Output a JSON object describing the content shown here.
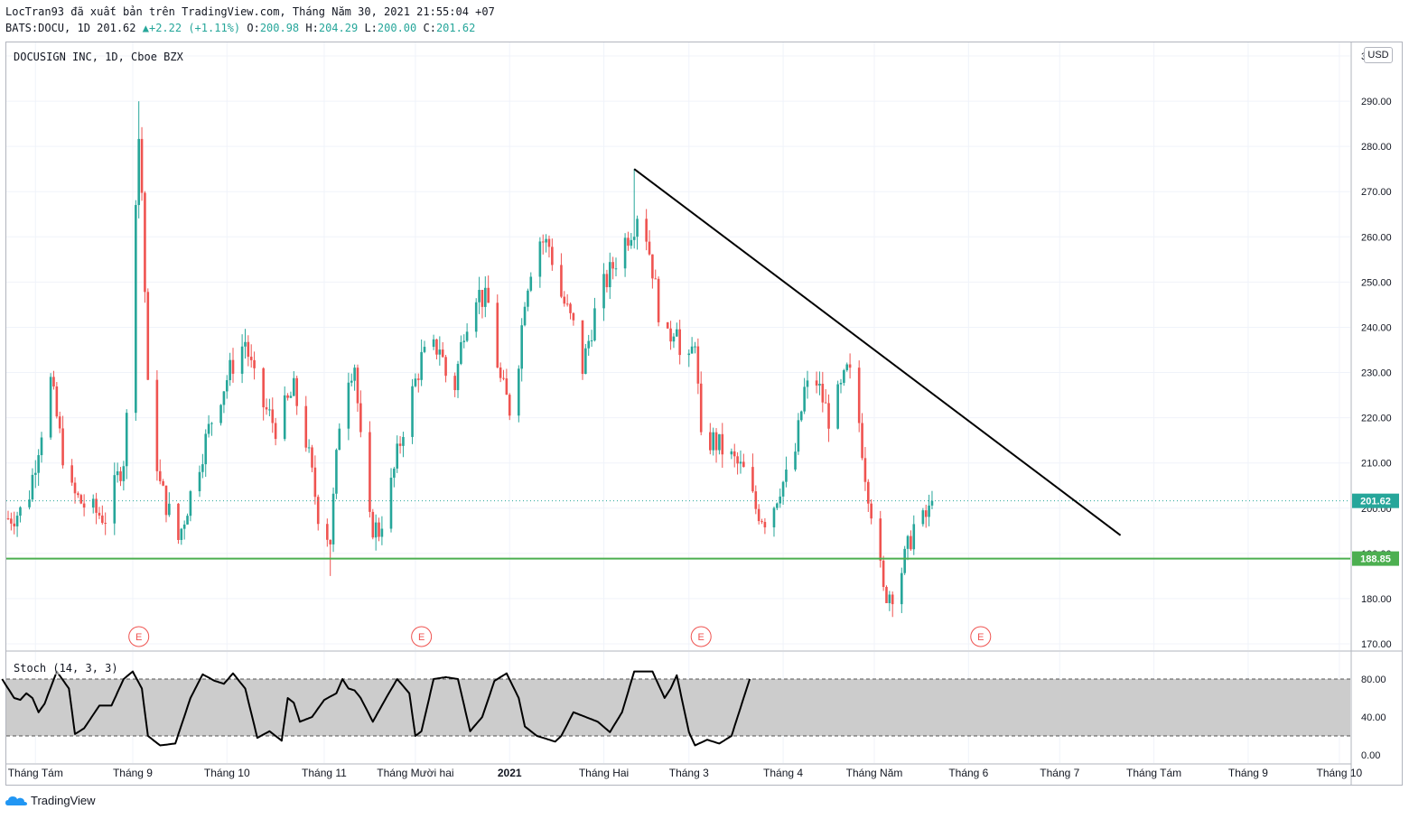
{
  "header": {
    "line1": "LocTran93 đã xuất bản trên TradingView.com, Tháng Năm 30, 2021 21:55:04 +07",
    "symbol_line": "BATS:DOCU, 1D 201.62",
    "change": "+2.22 (+1.11%)",
    "o_label": "O:",
    "o": "200.98",
    "h_label": "H:",
    "h": "204.29",
    "l_label": "L:",
    "l": "200.00",
    "c_label": "C:",
    "c": "201.62"
  },
  "symbol_title": "DOCUSIGN INC, 1D, Cboe BZX",
  "currency": "USD",
  "stoch_label": "Stoch (14, 3, 3)",
  "brand": "TradingView",
  "colors": {
    "up": "#26a69a",
    "down": "#ef5350",
    "support": "#4caf50",
    "trendline": "#000000",
    "stoch_band": "#cccccc"
  },
  "chart_data": [
    {
      "type": "candlestick",
      "title": "DOCUSIGN INC, 1D, Cboe BZX",
      "ylim": [
        170,
        300
      ],
      "y_ticks": [
        "170.00",
        "180.00",
        "190.00",
        "200.00",
        "210.00",
        "220.00",
        "230.00",
        "240.00",
        "250.00",
        "260.00",
        "270.00",
        "280.00",
        "290.00",
        "300.00"
      ],
      "x_ticks": [
        "Tháng Tám",
        "Tháng 9",
        "Tháng 10",
        "Tháng 11",
        "Tháng Mười hai",
        "2021",
        "Tháng Hai",
        "Tháng 3",
        "Tháng 4",
        "Tháng Năm",
        "Tháng 6",
        "Tháng 7",
        "Tháng Tám",
        "Tháng 9",
        "Tháng 10"
      ],
      "x_tick_days": [
        9,
        41,
        72,
        104,
        134,
        165,
        196,
        224,
        255,
        285,
        316,
        346,
        377,
        408,
        438
      ],
      "last_price": "201.62",
      "last_value": 201.62,
      "support_label": "188.85",
      "support_level": 188.85,
      "trendline": {
        "from": {
          "day": 206,
          "price": 275
        },
        "to": {
          "day": 366,
          "price": 194
        }
      },
      "earnings_markers": {
        "label": "E",
        "days": [
          43,
          136,
          228,
          320
        ]
      },
      "anchors": [
        [
          -2,
          197
        ],
        [
          6,
          200
        ],
        [
          14,
          228
        ],
        [
          20,
          204
        ],
        [
          26,
          200
        ],
        [
          32,
          198
        ],
        [
          38,
          211
        ],
        [
          41,
          237
        ],
        [
          42,
          270
        ],
        [
          43,
          282
        ],
        [
          44,
          270
        ],
        [
          46,
          226
        ],
        [
          50,
          205
        ],
        [
          56,
          193
        ],
        [
          62,
          208
        ],
        [
          68,
          222
        ],
        [
          74,
          232
        ],
        [
          78,
          237
        ],
        [
          82,
          225
        ],
        [
          88,
          218
        ],
        [
          94,
          226
        ],
        [
          98,
          215
        ],
        [
          102,
          199
        ],
        [
          106,
          193
        ],
        [
          110,
          228
        ],
        [
          114,
          232
        ],
        [
          118,
          197
        ],
        [
          122,
          195
        ],
        [
          126,
          205
        ],
        [
          130,
          218
        ],
        [
          136,
          233
        ],
        [
          142,
          236
        ],
        [
          146,
          223
        ],
        [
          150,
          240
        ],
        [
          154,
          248
        ],
        [
          158,
          245
        ],
        [
          162,
          228
        ],
        [
          166,
          220
        ],
        [
          170,
          247
        ],
        [
          174,
          260
        ],
        [
          178,
          258
        ],
        [
          182,
          247
        ],
        [
          186,
          240
        ],
        [
          188,
          228
        ],
        [
          190,
          234
        ],
        [
          194,
          246
        ],
        [
          198,
          252
        ],
        [
          202,
          258
        ],
        [
          206,
          263
        ],
        [
          208,
          268
        ],
        [
          212,
          253
        ],
        [
          216,
          235
        ],
        [
          220,
          242
        ],
        [
          222,
          225
        ],
        [
          226,
          238
        ],
        [
          228,
          214
        ],
        [
          232,
          215
        ],
        [
          238,
          211
        ],
        [
          242,
          208
        ],
        [
          246,
          200
        ],
        [
          250,
          197
        ],
        [
          254,
          205
        ],
        [
          258,
          208
        ],
        [
          262,
          226
        ],
        [
          266,
          228
        ],
        [
          270,
          220
        ],
        [
          274,
          226
        ],
        [
          276,
          230
        ],
        [
          278,
          228
        ],
        [
          280,
          219
        ],
        [
          282,
          208
        ],
        [
          284,
          200
        ],
        [
          286,
          191
        ],
        [
          288,
          181
        ],
        [
          292,
          182
        ],
        [
          296,
          191
        ],
        [
          298,
          196
        ],
        [
          300,
          196
        ],
        [
          304,
          200
        ]
      ],
      "earnings_label": "E"
    },
    {
      "type": "line",
      "title": "Stoch (14, 3, 3)",
      "ylim": [
        0,
        100
      ],
      "y_ticks": [
        "0.00",
        "40.00",
        "80.00"
      ],
      "bands": [
        20,
        80
      ],
      "anchors": [
        [
          -2,
          80
        ],
        [
          2,
          60
        ],
        [
          4,
          58
        ],
        [
          6,
          65
        ],
        [
          8,
          60
        ],
        [
          10,
          45
        ],
        [
          12,
          54
        ],
        [
          16,
          88
        ],
        [
          20,
          70
        ],
        [
          22,
          22
        ],
        [
          25,
          28
        ],
        [
          30,
          52
        ],
        [
          34,
          52
        ],
        [
          38,
          80
        ],
        [
          41,
          88
        ],
        [
          44,
          70
        ],
        [
          46,
          20
        ],
        [
          50,
          10
        ],
        [
          55,
          12
        ],
        [
          60,
          60
        ],
        [
          64,
          85
        ],
        [
          68,
          78
        ],
        [
          71,
          75
        ],
        [
          74,
          86
        ],
        [
          78,
          70
        ],
        [
          82,
          18
        ],
        [
          86,
          25
        ],
        [
          88,
          20
        ],
        [
          90,
          15
        ],
        [
          92,
          60
        ],
        [
          94,
          55
        ],
        [
          96,
          35
        ],
        [
          100,
          40
        ],
        [
          104,
          58
        ],
        [
          108,
          65
        ],
        [
          110,
          80
        ],
        [
          112,
          70
        ],
        [
          114,
          68
        ],
        [
          116,
          60
        ],
        [
          120,
          35
        ],
        [
          124,
          58
        ],
        [
          128,
          80
        ],
        [
          132,
          65
        ],
        [
          134,
          20
        ],
        [
          136,
          25
        ],
        [
          140,
          80
        ],
        [
          144,
          82
        ],
        [
          148,
          80
        ],
        [
          152,
          25
        ],
        [
          156,
          40
        ],
        [
          160,
          78
        ],
        [
          164,
          86
        ],
        [
          168,
          60
        ],
        [
          170,
          30
        ],
        [
          174,
          20
        ],
        [
          178,
          16
        ],
        [
          180,
          14
        ],
        [
          182,
          20
        ],
        [
          186,
          45
        ],
        [
          190,
          40
        ],
        [
          194,
          35
        ],
        [
          198,
          24
        ],
        [
          202,
          45
        ],
        [
          206,
          88
        ],
        [
          212,
          88
        ],
        [
          216,
          60
        ],
        [
          218,
          70
        ],
        [
          220,
          84
        ],
        [
          224,
          24
        ],
        [
          226,
          10
        ],
        [
          230,
          16
        ],
        [
          234,
          12
        ],
        [
          238,
          20
        ],
        [
          242,
          60
        ],
        [
          244,
          80
        ]
      ]
    }
  ]
}
